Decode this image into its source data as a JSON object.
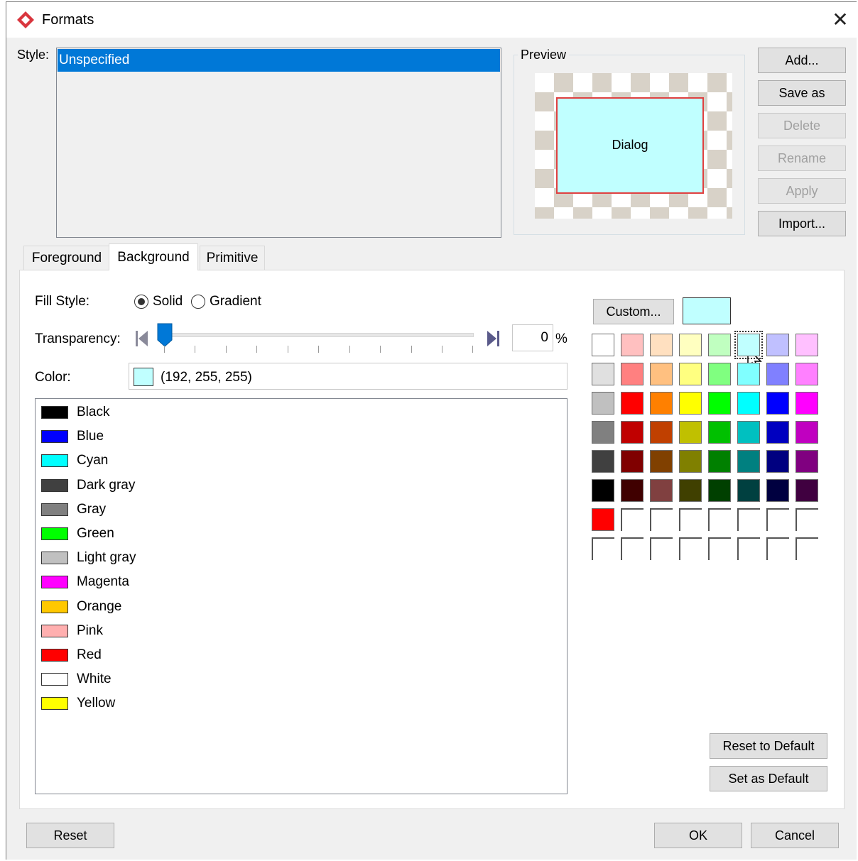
{
  "window": {
    "title": "Formats"
  },
  "style": {
    "label": "Style:",
    "selected": "Unspecified"
  },
  "preview": {
    "label": "Preview",
    "shape_text": "Dialog",
    "fill_color": "#c0ffff",
    "border_color": "#e04040"
  },
  "side_buttons": {
    "add": "Add...",
    "save_as": "Save as",
    "delete": "Delete",
    "rename": "Rename",
    "apply": "Apply",
    "import": "Import..."
  },
  "tabs": [
    {
      "label": "Foreground",
      "active": false
    },
    {
      "label": "Background",
      "active": true
    },
    {
      "label": "Primitive",
      "active": false
    }
  ],
  "fill_style": {
    "label": "Fill Style:",
    "options": [
      "Solid",
      "Gradient"
    ],
    "selected": "Solid"
  },
  "transparency": {
    "label": "Transparency:",
    "value": "0",
    "unit": "%",
    "level": 0
  },
  "color": {
    "label": "Color:",
    "value_text": "(192, 255, 255)",
    "swatch": "#c0ffff"
  },
  "named_colors": [
    {
      "name": "Black",
      "hex": "#000000"
    },
    {
      "name": "Blue",
      "hex": "#0000ff"
    },
    {
      "name": "Cyan",
      "hex": "#00ffff"
    },
    {
      "name": "Dark gray",
      "hex": "#404040"
    },
    {
      "name": "Gray",
      "hex": "#808080"
    },
    {
      "name": "Green",
      "hex": "#00ff00"
    },
    {
      "name": "Light gray",
      "hex": "#c0c0c0"
    },
    {
      "name": "Magenta",
      "hex": "#ff00ff"
    },
    {
      "name": "Orange",
      "hex": "#ffc800"
    },
    {
      "name": "Pink",
      "hex": "#ffafaf"
    },
    {
      "name": "Red",
      "hex": "#ff0000"
    },
    {
      "name": "White",
      "hex": "#ffffff"
    },
    {
      "name": "Yellow",
      "hex": "#ffff00"
    }
  ],
  "palette": {
    "custom_label": "Custom...",
    "custom_swatch": "#c0ffff",
    "selected": "#c0ffff",
    "rows": [
      [
        "#ffffff",
        "#ffc0c0",
        "#ffe0c0",
        "#ffffc0",
        "#c0ffc0",
        "#c0ffff",
        "#c0c0ff",
        "#ffc0ff"
      ],
      [
        "#e0e0e0",
        "#ff8080",
        "#ffc080",
        "#ffff80",
        "#80ff80",
        "#80ffff",
        "#8080ff",
        "#ff80ff"
      ],
      [
        "#c0c0c0",
        "#ff0000",
        "#ff8000",
        "#ffff00",
        "#00ff00",
        "#00ffff",
        "#0000ff",
        "#ff00ff"
      ],
      [
        "#808080",
        "#c00000",
        "#c04000",
        "#c0c000",
        "#00c000",
        "#00c0c0",
        "#0000c0",
        "#c000c0"
      ],
      [
        "#404040",
        "#800000",
        "#804000",
        "#808000",
        "#008000",
        "#008080",
        "#000080",
        "#800080"
      ],
      [
        "#000000",
        "#400000",
        "#804040",
        "#404000",
        "#004000",
        "#004040",
        "#000040",
        "#400040"
      ],
      [
        "#ff0000",
        "",
        "",
        "",
        "",
        "",
        "",
        ""
      ],
      [
        "",
        "",
        "",
        "",
        "",
        "",
        "",
        ""
      ]
    ]
  },
  "defaults": {
    "reset_to_default": "Reset to Default",
    "set_as_default": "Set as Default"
  },
  "footer": {
    "reset": "Reset",
    "ok": "OK",
    "cancel": "Cancel"
  }
}
